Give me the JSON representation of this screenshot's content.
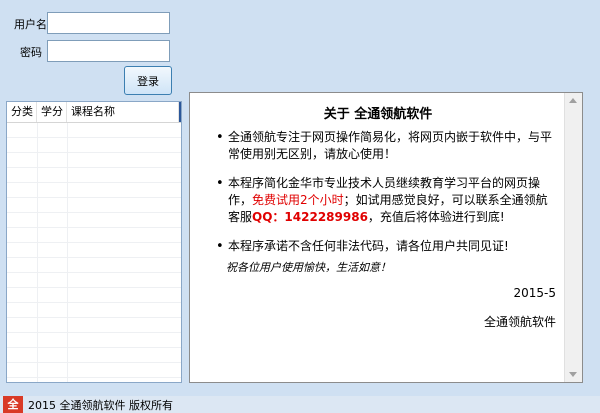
{
  "login": {
    "username_label": "用户名",
    "password_label": "密码",
    "username_value": "",
    "password_value": "",
    "login_button": "登录"
  },
  "course_list": {
    "columns": [
      "分类",
      "学分",
      "课程名称"
    ],
    "rows": []
  },
  "about": {
    "title": "关于 全通领航软件",
    "item1": "全通领航专注于网页操作简易化，将网页内嵌于软件中，与平常使用别无区别，请放心使用！",
    "item2_part1": "本程序简化金华市专业技术人员继续教育学习平台的网页操作，",
    "item2_trial": "免费试用2个小时",
    "item2_part2": "；如试用感觉良好，可以联系全通领航客服",
    "item2_qq": "QQ：1422289986",
    "item2_part3": "，充值后将体验进行到底!",
    "item3": "本程序承诺不含任何非法代码，请各位用户共同见证!",
    "blessing": "祝各位用户使用愉快，生活如意！",
    "date": "2015-5",
    "signature": "全通领航软件"
  },
  "footer": {
    "logo_char": "全",
    "copyright": "2015 全通领航软件 版权所有"
  },
  "colors": {
    "background": "#cfe0f2",
    "highlight_red": "#e00000"
  }
}
